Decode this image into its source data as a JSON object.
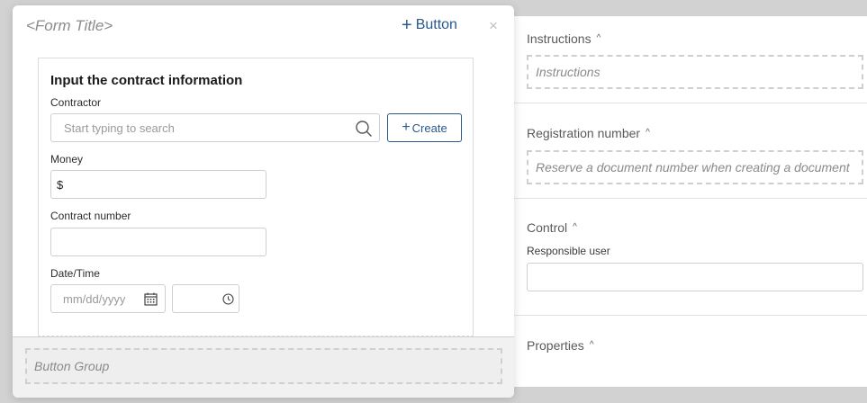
{
  "modal": {
    "form_title": "<Form Title>",
    "top_button_label": "Button",
    "close_glyph": "×",
    "card": {
      "heading": "Input the contract information",
      "contractor": {
        "label": "Contractor",
        "placeholder": "Start typing to search",
        "create_label": "Create"
      },
      "money": {
        "label": "Money",
        "value": "$"
      },
      "contract_number": {
        "label": "Contract number",
        "value": ""
      },
      "date_time": {
        "label": "Date/Time",
        "date_placeholder": "mm/dd/yyyy"
      }
    },
    "footer": {
      "button_group_label": "Button Group"
    }
  },
  "right_panel": {
    "instructions": {
      "title": "Instructions",
      "placeholder": "Instructions"
    },
    "registration": {
      "title": "Registration number",
      "placeholder": "Reserve a document number when creating a document"
    },
    "control": {
      "title": "Control",
      "responsible_label": "Responsible user"
    },
    "properties": {
      "title": "Properties"
    }
  },
  "icons": {
    "plus": "+",
    "caret_up": "^",
    "search": "search-icon",
    "calendar": "calendar-icon",
    "clock": "clock-icon"
  },
  "colors": {
    "accent": "#2a5a8c",
    "placeholder_text": "#8a8a8a",
    "backdrop": "#d2d2d2"
  }
}
